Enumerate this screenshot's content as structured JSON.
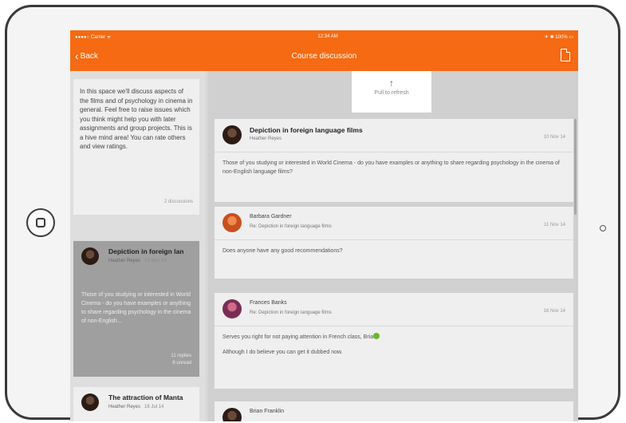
{
  "status": {
    "carrier": "●●●●○ Carrier ᯤ",
    "time": "12:34 AM",
    "battery": "✈ ✱ 100% ▭"
  },
  "nav": {
    "back_label": "Back",
    "title": "Course discussion"
  },
  "refresh": {
    "label": "Pull to refresh"
  },
  "description": {
    "text": "In this space we'll discuss aspects of the films and of psychology in cinema in general. Feel free to raise issues which you think might help you with later assignments and group projects. This is a hive mind area! You can rate others and view ratings.",
    "count": "2 discussions"
  },
  "discussions": [
    {
      "title": "Depiction in foreign lan",
      "author": "Heather Reyes",
      "date": "10 Nov 14",
      "snippet": "Those of you studying or interested in World Cinema - do you have examples or anything to share regarding psychology in the cinema of non-English...",
      "replies": "11 replies",
      "unread": "8 unread"
    },
    {
      "title": "The attraction of Manta",
      "author": "Heather Reyes",
      "date": "16 Jul 14"
    }
  ],
  "posts": [
    {
      "title": "Depiction in foreign language films",
      "subtitle": "Heather Reyes",
      "date": "10 Nov 14",
      "body": "Those of you studying or interested in World Cinema - do you have examples or anything to share regarding psychology in the cinema of non-English language films?"
    },
    {
      "title": "Barbara Gardner",
      "subtitle": "Re: Depiction in foreign language films",
      "date": "11 Nov 14",
      "body": "Does anyone have any good recommendations?"
    },
    {
      "title": "Frances Banks",
      "subtitle": "Re: Depiction in foreign language films",
      "date": "16 Nov 14",
      "body": "Serves you right for not paying attention in French class, Bria",
      "body2": "Although I do believe you can get it dubbed now."
    },
    {
      "title": "Brian Franklin"
    }
  ],
  "colors": {
    "accent": "#f56a12"
  },
  "icons": {
    "back": "chevron-left-icon",
    "refresh": "arrow-up-icon",
    "doc": "document-icon",
    "emoji": "smiley-icon"
  }
}
